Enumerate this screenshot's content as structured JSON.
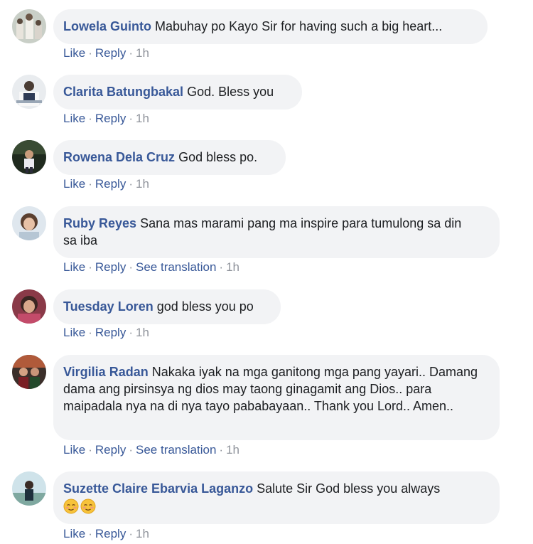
{
  "comments": [
    {
      "author": "Lowela Guinto",
      "text": "Mabuhay po Kayo Sir for having such a big heart...",
      "actions": {
        "like": "Like",
        "reply": "Reply",
        "time": "1h"
      }
    },
    {
      "author": "Clarita Batungbakal",
      "text": "God. Bless you",
      "actions": {
        "like": "Like",
        "reply": "Reply",
        "time": "1h"
      }
    },
    {
      "author": "Rowena Dela Cruz",
      "text": "God bless po.",
      "actions": {
        "like": "Like",
        "reply": "Reply",
        "time": "1h"
      }
    },
    {
      "author": "Ruby Reyes",
      "text": "Sana mas marami pang ma inspire para tumulong sa din sa iba",
      "actions": {
        "like": "Like",
        "reply": "Reply",
        "translate": "See translation",
        "time": "1h"
      }
    },
    {
      "author": "Tuesday Loren",
      "text": "god bless you po",
      "actions": {
        "like": "Like",
        "reply": "Reply",
        "time": "1h"
      }
    },
    {
      "author": "Virgilia Radan",
      "text": "Nakaka iyak na mga ganitong mga pang yayari.. Damang dama ang pirsinsya ng dios may taong ginagamit ang Dios.. para maipadala nya na di nya tayo pababayaan.. Thank you Lord.. Amen..",
      "actions": {
        "like": "Like",
        "reply": "Reply",
        "translate": "See translation",
        "time": "1h"
      }
    },
    {
      "author": "Suzette Claire Ebarvia Laganzo",
      "text": "Salute Sir God bless you always",
      "emojis": [
        "relieved-face-emoji",
        "relieved-face-emoji"
      ],
      "actions": {
        "like": "Like",
        "reply": "Reply",
        "time": "1h"
      }
    }
  ],
  "colors": {
    "link": "#385898",
    "meta": "#90949c",
    "bubble": "#f2f3f5",
    "text": "#1c1e21"
  }
}
